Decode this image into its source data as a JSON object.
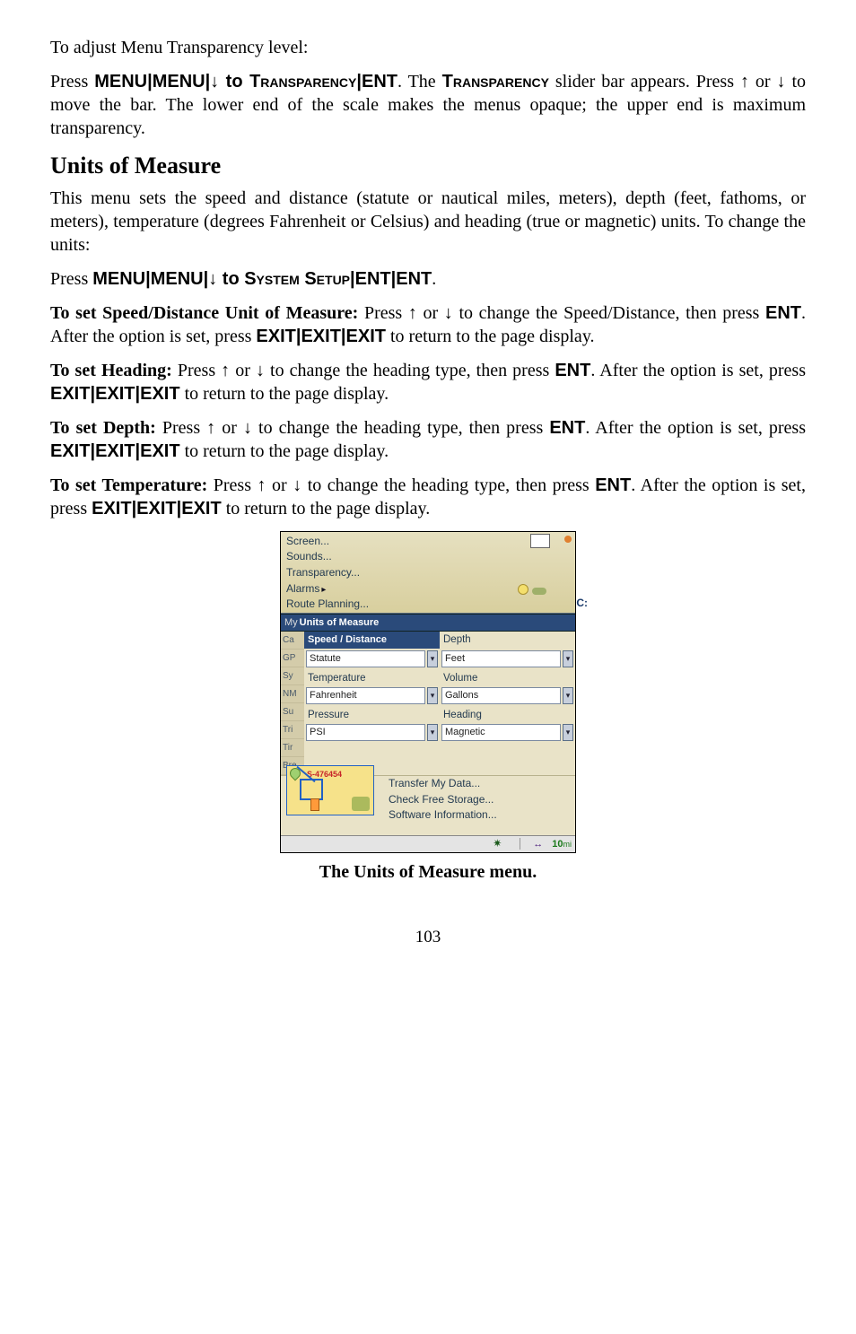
{
  "p_intro_transparency": "To adjust Menu Transparency level:",
  "p_trans_1a": "Press ",
  "p_trans_1b": "MENU",
  "p_trans_1c": "|",
  "p_trans_1d": "MENU",
  "p_trans_1e": "|↓ to ",
  "p_trans_1f": "Transparency",
  "p_trans_1g": "|",
  "p_trans_1h": "ENT",
  "p_trans_1i": ". The ",
  "p_trans_1j": "Transparency",
  "p_trans_1k": " slider bar appears. Press ↑ or ↓ to move the bar. The lower end of the scale makes the menus opaque; the upper end is maximum transparency.",
  "h_units": "Units of Measure",
  "p_units_intro": "This menu sets the speed and distance (statute or nautical miles, meters), depth (feet, fathoms, or meters), temperature (degrees Fahrenheit or Celsius) and heading (true or magnetic) units. To change the units:",
  "p_units_press_a": "Press ",
  "p_units_press_b": "MENU",
  "p_units_press_c": "|",
  "p_units_press_d": "MENU",
  "p_units_press_e": "|↓ to ",
  "p_units_press_f": "System Setup",
  "p_units_press_g": "|",
  "p_units_press_h": "ENT",
  "p_units_press_i": "|",
  "p_units_press_j": "ENT",
  "p_units_press_k": ".",
  "sd_label": "To set Speed/Distance Unit of Measure:",
  "sd_a": " Press ↑ or ↓ to change the Speed/Distance, then press ",
  "sd_ent": "ENT",
  "sd_b": ". After the option is set, press ",
  "sd_exit": "EXIT",
  "sd_pipe": "|",
  "sd_c": " to return to the page display.",
  "hd_label": "To set Heading:",
  "hd_a": " Press ↑ or ↓ to change the heading type, then press ",
  "hd_b": ". After the option is set, press ",
  "hd_c": " to return to the page display.",
  "dp_label": "To set Depth:",
  "dp_a": " Press ↑ or ↓ to change the heading type, then press ",
  "dp_b": ". After the option is set, press ",
  "dp_c": " to return to the page display.",
  "tp_label": "To set Temperature:",
  "tp_a": " Press ↑ or ↓ to change the heading type, then press ",
  "tp_b": ". After the option is set, press ",
  "tp_c": " to return to the page display.",
  "shot": {
    "top_menu": [
      "Screen...",
      "Sounds...",
      "Transparency...",
      "Alarms",
      "Route Planning..."
    ],
    "alarms_arrow": "▸",
    "c_label": "C:",
    "units_bar_my": "My",
    "units_bar": "Units of Measure",
    "side": [
      "Ca",
      "GP",
      "Sy",
      "NM",
      "Su",
      "Tri",
      "Tir",
      "Bre"
    ],
    "col_left_hdr": "Speed / Distance",
    "col_right_hdr": "Depth",
    "fields": {
      "speed": "Statute",
      "depth": "Feet",
      "temp_lbl": "Temperature",
      "vol_lbl": "Volume",
      "temp": "Fahrenheit",
      "vol": "Gallons",
      "press_lbl": "Pressure",
      "head_lbl": "Heading",
      "press": "PSI",
      "head": "Magnetic"
    },
    "dd_glyph": "▾",
    "lower": [
      "Transfer My Data...",
      "Check Free Storage...",
      "Software Information..."
    ],
    "thumb_red": "S-476454",
    "status_arrow": "↔",
    "status_dist": "10",
    "status_unit": "mi"
  },
  "caption": "The Units of Measure menu.",
  "page_num": "103"
}
